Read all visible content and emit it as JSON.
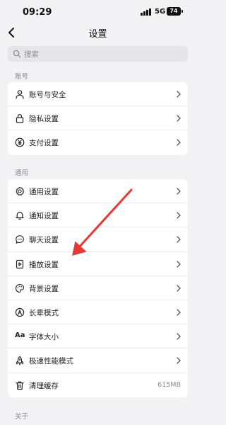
{
  "status_bar": {
    "time": "09:29",
    "network": "5G",
    "battery": "74"
  },
  "header": {
    "title": "设置"
  },
  "search": {
    "placeholder": "搜索"
  },
  "sections": [
    {
      "title": "账号",
      "items": [
        {
          "label": "账号与安全",
          "icon": "person-icon"
        },
        {
          "label": "隐私设置",
          "icon": "lock-icon"
        },
        {
          "label": "支付设置",
          "icon": "yen-icon"
        }
      ]
    },
    {
      "title": "通用",
      "items": [
        {
          "label": "通用设置",
          "icon": "gear-icon"
        },
        {
          "label": "通知设置",
          "icon": "bell-icon"
        },
        {
          "label": "聊天设置",
          "icon": "chat-bubble-icon"
        },
        {
          "label": "播放设置",
          "icon": "play-box-icon"
        },
        {
          "label": "背景设置",
          "icon": "palette-icon"
        },
        {
          "label": "长辈模式",
          "icon": "elder-mode-icon"
        },
        {
          "label": "字体大小",
          "icon": "font-size-icon",
          "icon_text": "Aa"
        },
        {
          "label": "极速性能模式",
          "icon": "rocket-icon"
        },
        {
          "label": "清理缓存",
          "icon": "trash-icon",
          "value": "615MB"
        }
      ]
    },
    {
      "title": "关于"
    }
  ],
  "annotation": {
    "arrow_color": "#e53935"
  }
}
